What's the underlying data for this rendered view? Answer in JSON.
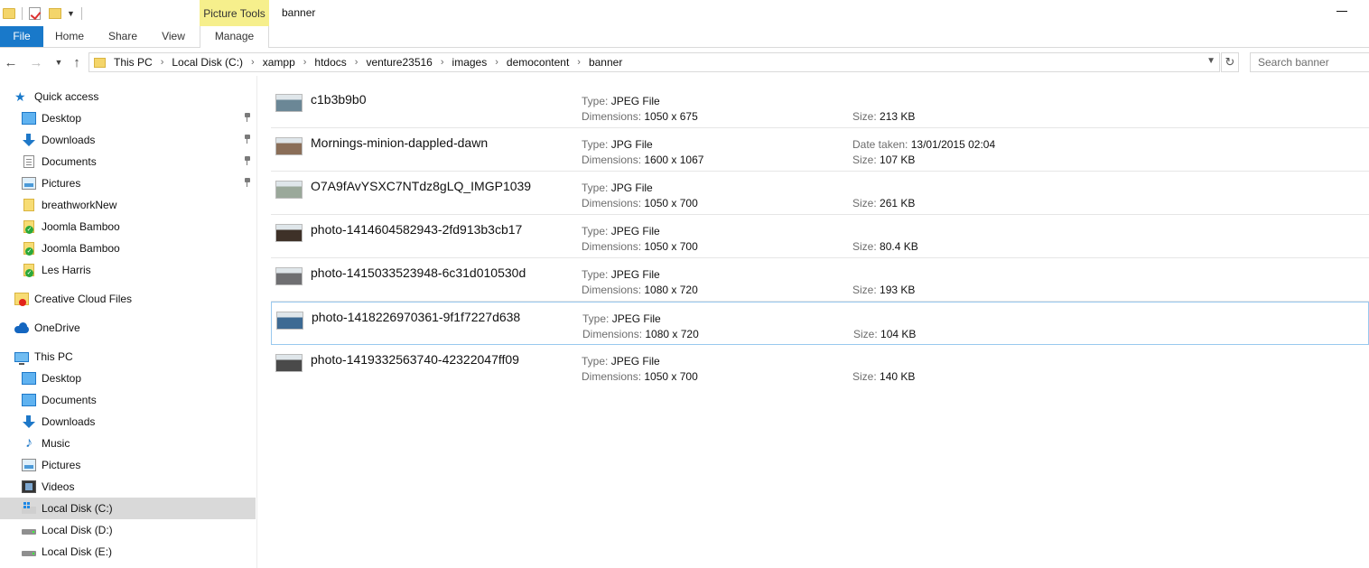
{
  "window": {
    "title": "banner",
    "context_tab": "Picture Tools"
  },
  "ribbon": {
    "tabs": [
      "File",
      "Home",
      "Share",
      "View",
      "Manage"
    ]
  },
  "address_bar": {
    "crumbs": [
      "This PC",
      "Local Disk (C:)",
      "xampp",
      "htdocs",
      "venture23516",
      "images",
      "democontent",
      "banner"
    ]
  },
  "search": {
    "placeholder": "Search banner"
  },
  "nav_pane": {
    "quick_access": "Quick access",
    "quick_access_items": [
      {
        "label": "Desktop",
        "icon": "desktop-icon",
        "pinned": true
      },
      {
        "label": "Downloads",
        "icon": "downloads-icon",
        "pinned": true
      },
      {
        "label": "Documents",
        "icon": "documents-icon",
        "pinned": true
      },
      {
        "label": "Pictures",
        "icon": "pictures-icon",
        "pinned": true
      },
      {
        "label": "breathworkNew",
        "icon": "folder-icon",
        "pinned": false
      },
      {
        "label": "Joomla Bamboo",
        "icon": "synced-folder-icon",
        "pinned": false
      },
      {
        "label": "Joomla Bamboo",
        "icon": "synced-folder-icon",
        "pinned": false
      },
      {
        "label": "Les Harris",
        "icon": "synced-folder-icon",
        "pinned": false
      }
    ],
    "creative_cloud": "Creative Cloud Files",
    "onedrive": "OneDrive",
    "this_pc": "This PC",
    "this_pc_items": [
      {
        "label": "Desktop",
        "icon": "desktop-icon"
      },
      {
        "label": "Documents",
        "icon": "documents-icon"
      },
      {
        "label": "Downloads",
        "icon": "downloads-icon"
      },
      {
        "label": "Music",
        "icon": "music-icon"
      },
      {
        "label": "Pictures",
        "icon": "pictures-icon"
      },
      {
        "label": "Videos",
        "icon": "videos-icon"
      },
      {
        "label": "Local Disk (C:)",
        "icon": "windows-drive-icon",
        "selected": true
      },
      {
        "label": "Local Disk (D:)",
        "icon": "drive-icon"
      },
      {
        "label": "Local Disk (E:)",
        "icon": "drive-icon"
      }
    ]
  },
  "labels": {
    "type": "Type:",
    "dimensions": "Dimensions:",
    "size": "Size:",
    "date_taken": "Date taken:"
  },
  "files": [
    {
      "name": "c1b3b9b0",
      "type": "JPEG File",
      "dimensions": "1050 x 675",
      "date_taken": "",
      "size": "213 KB",
      "thumb_color": "#6b8796"
    },
    {
      "name": "Mornings-minion-dappled-dawn",
      "type": "JPG File",
      "dimensions": "1600 x 1067",
      "date_taken": "13/01/2015 02:04",
      "size": "107 KB",
      "thumb_color": "#8a6e58"
    },
    {
      "name": "O7A9fAvYSXC7NTdz8gLQ_IMGP1039",
      "type": "JPG File",
      "dimensions": "1050 x 700",
      "date_taken": "",
      "size": "261 KB",
      "thumb_color": "#9aa89a"
    },
    {
      "name": "photo-1414604582943-2fd913b3cb17",
      "type": "JPEG File",
      "dimensions": "1050 x 700",
      "date_taken": "",
      "size": "80.4 KB",
      "thumb_color": "#3e3128"
    },
    {
      "name": "photo-1415033523948-6c31d010530d",
      "type": "JPEG File",
      "dimensions": "1080 x 720",
      "date_taken": "",
      "size": "193 KB",
      "thumb_color": "#6f6f72"
    },
    {
      "name": "photo-1418226970361-9f1f7227d638",
      "type": "JPEG File",
      "dimensions": "1080 x 720",
      "date_taken": "",
      "size": "104 KB",
      "thumb_color": "#3d6a93",
      "selected": true
    },
    {
      "name": "photo-1419332563740-42322047ff09",
      "type": "JPEG File",
      "dimensions": "1050 x 700",
      "date_taken": "",
      "size": "140 KB",
      "thumb_color": "#4a4a4a"
    }
  ]
}
